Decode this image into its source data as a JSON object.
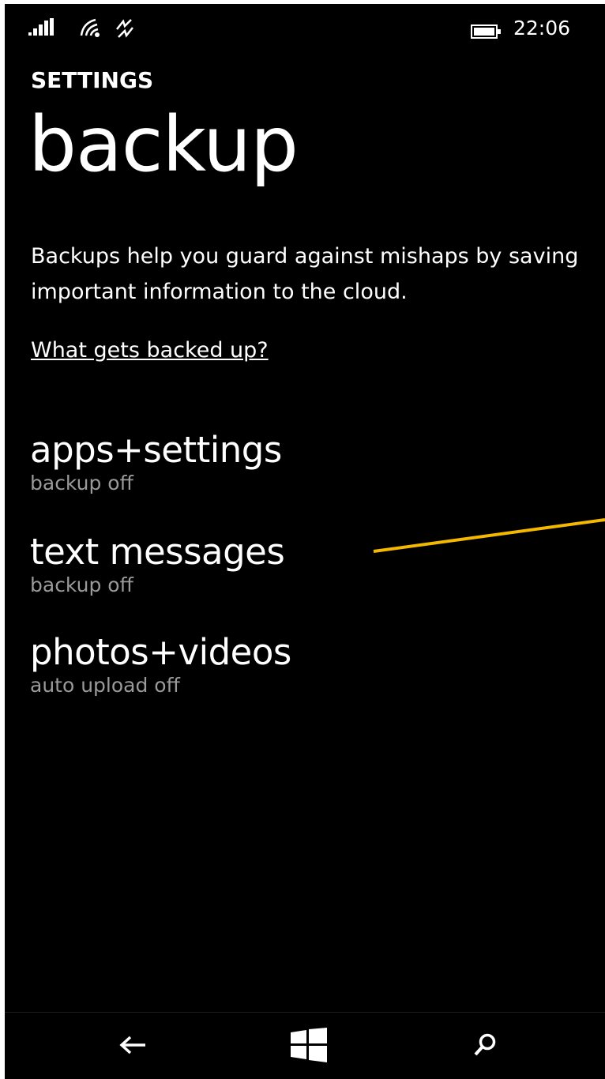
{
  "status_bar": {
    "time": "22:06",
    "icons": [
      "signal-icon",
      "wifi-calling-icon",
      "data-sync-icon",
      "battery-icon"
    ]
  },
  "header": {
    "section": "SETTINGS",
    "title": "backup"
  },
  "description": "Backups help you guard against mishaps by saving important information to the cloud.",
  "link": "What gets backed up?",
  "items": [
    {
      "title": "apps+settings",
      "subtitle": "backup off"
    },
    {
      "title": "text messages",
      "subtitle": "backup off"
    },
    {
      "title": "photos+videos",
      "subtitle": "auto upload off"
    }
  ],
  "nav_bar": {
    "icons": [
      "back-arrow-icon",
      "windows-start-icon",
      "search-icon"
    ]
  },
  "colors": {
    "background": "#000000",
    "text": "#ffffff",
    "subtext": "#9a9a9a",
    "annotation": "#f5b800"
  }
}
